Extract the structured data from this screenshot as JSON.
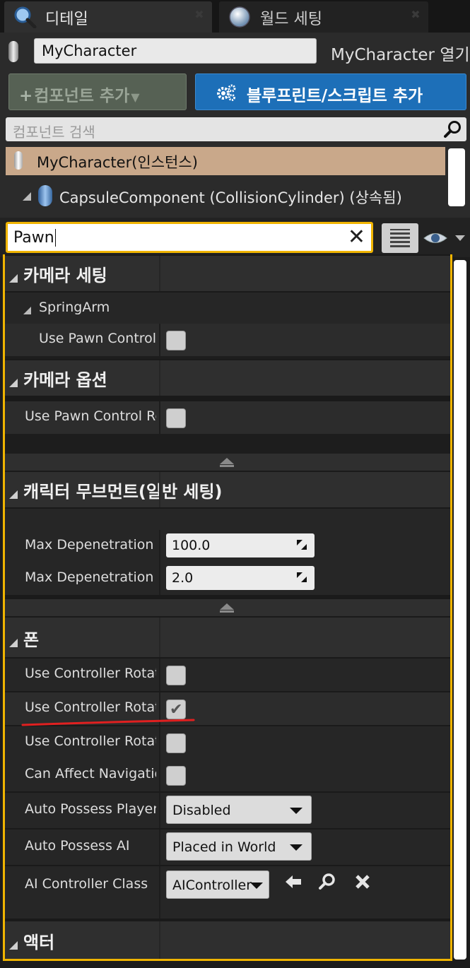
{
  "tabs": [
    {
      "label": "디테일",
      "icon": "magnifier-icon",
      "active": true
    },
    {
      "label": "월드 세팅",
      "icon": "globe-icon",
      "active": false
    }
  ],
  "header": {
    "actor_name": "MyCharacter",
    "open_link": "MyCharacter 열기"
  },
  "toolbar": {
    "add_component_label": "컴포넌트 추가",
    "blueprint_label": "블루프린트/스크립트 추가"
  },
  "component_search": {
    "placeholder": "컴포넌트 검색"
  },
  "component_tree": [
    {
      "label": "MyCharacter(인스턴스)",
      "selected": true
    },
    {
      "label": "CapsuleComponent (CollisionCylinder) (상속됨)",
      "selected": false
    }
  ],
  "details_filter": {
    "value": "Pawn"
  },
  "sections": {
    "camera_settings": {
      "title": "카메라 세팅",
      "sub_title": "SpringArm",
      "row_label": "Use Pawn Control Rotation",
      "checked": false
    },
    "camera_options": {
      "title": "카메라 옵션",
      "row_label": "Use Pawn Control Rotation",
      "checked": false
    },
    "char_movement": {
      "title": "캐릭터 무브먼트(일반 세팅)",
      "rows": [
        {
          "label": "Max Depenetration with Geometry",
          "value": "100.0"
        },
        {
          "label": "Max Depenetration with Pawn",
          "value": "2.0"
        }
      ]
    },
    "pawn": {
      "title": "폰",
      "rows": [
        {
          "label": "Use Controller Rotation Pitch",
          "checked": false
        },
        {
          "label": "Use Controller Rotation Yaw",
          "checked": true
        },
        {
          "label": "Use Controller Rotation Roll",
          "checked": false
        },
        {
          "label": "Can Affect Navigation Generation",
          "checked": false
        }
      ],
      "auto_possess_player": {
        "label": "Auto Possess Player",
        "value": "Disabled"
      },
      "auto_possess_ai": {
        "label": "Auto Possess AI",
        "value": "Placed in World"
      },
      "ai_controller_class": {
        "label": "AI Controller Class",
        "value": "AIController"
      }
    },
    "actor": {
      "title": "액터"
    }
  },
  "colors": {
    "accent_focus": "#f0b400",
    "blueprint_button": "#1d6fb8",
    "selected_row": "#c9a88a",
    "annotation_underline": "#e02020"
  }
}
